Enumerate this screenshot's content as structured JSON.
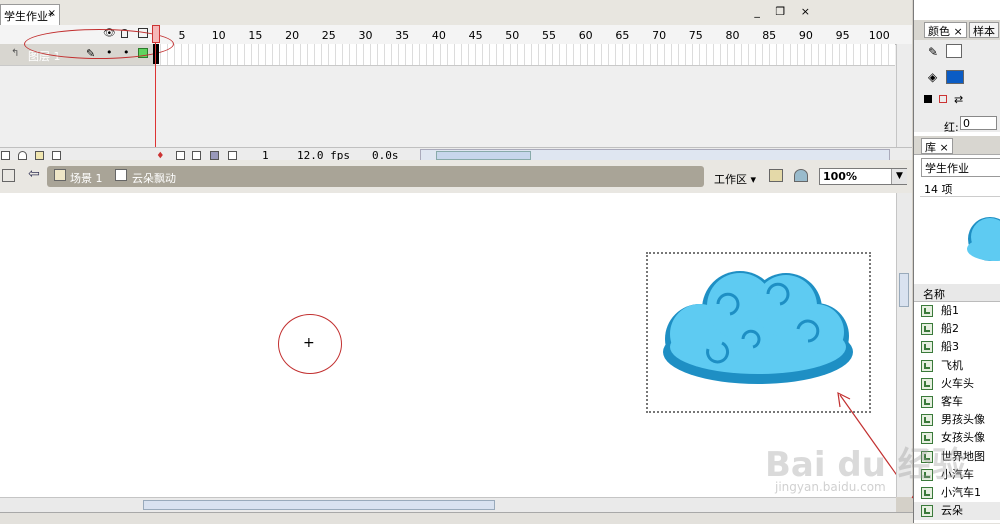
{
  "document": {
    "tab_title": "学生作业*",
    "close_glyph": "×"
  },
  "window_controls": {
    "minimize": "_",
    "restore": "❐",
    "close": "×"
  },
  "timeline": {
    "frame_numbers": [
      "1",
      "5",
      "10",
      "15",
      "20",
      "25",
      "30",
      "35",
      "40",
      "45",
      "50",
      "55",
      "60",
      "65",
      "70",
      "75",
      "80",
      "85",
      "90",
      "95",
      "100"
    ],
    "layer_name": "图层 1",
    "current_frame": "1",
    "fps": "12.0 fps",
    "elapsed": "0.0s"
  },
  "editbar": {
    "scene_label": "场景 1",
    "symbol_label": "云朵飘动",
    "workspace_label": "工作区",
    "zoom_value": "100%"
  },
  "stage": {
    "registration_mark": "+"
  },
  "color_panel": {
    "tab_color": "颜色",
    "tab_swatches": "样本",
    "red_label": "红:",
    "red_value": "0",
    "fill_color": "#0b5cc4"
  },
  "library": {
    "tab_label": "库",
    "document_name": "学生作业",
    "item_count": "14 项",
    "column_name": "名称",
    "items": [
      "船1",
      "船2",
      "船3",
      "飞机",
      "火车头",
      "客车",
      "男孩头像",
      "女孩头像",
      "世界地图",
      "小汽车",
      "小汽车1",
      "云朵"
    ]
  },
  "watermark": {
    "text": "Bai du 经验",
    "url": "jingyan.baidu.com"
  },
  "colors": {
    "annotation_red": "#c23030",
    "cloud_fill": "#5ecbf2",
    "cloud_outline": "#1e8fc4"
  }
}
